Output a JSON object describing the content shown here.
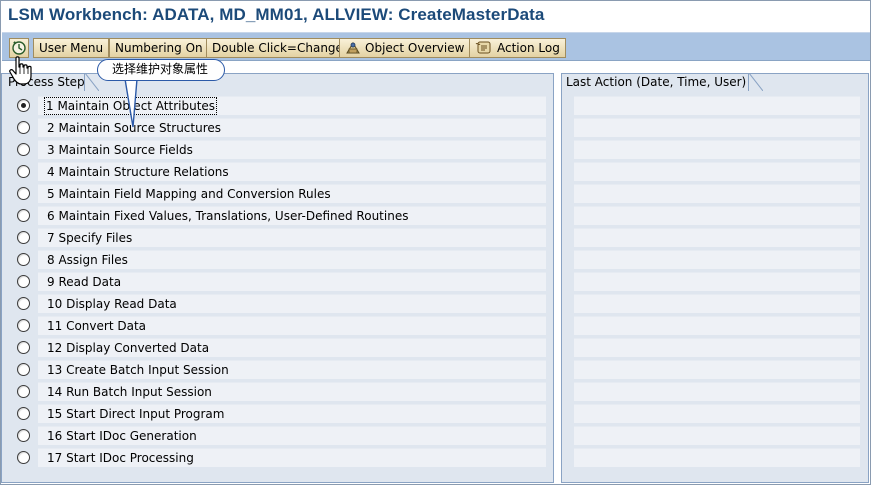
{
  "window": {
    "title": "LSM Workbench: ADATA, MD_MM01, ALLVIEW: CreateMasterData"
  },
  "toolbar": {
    "execute_icon": "execute-clock-icon",
    "buttons": [
      {
        "label": "User Menu"
      },
      {
        "label": "Numbering On"
      },
      {
        "label": "Double Click=Change"
      },
      {
        "label": "Object Overview",
        "icon": "object-overview-icon"
      },
      {
        "label": "Action Log",
        "icon": "action-log-icon"
      }
    ]
  },
  "tooltip": {
    "text": "选择维护对象属性"
  },
  "process_panel": {
    "header": "Process Step",
    "selected_index": 0,
    "steps": [
      {
        "label": "1 Maintain Object Attributes"
      },
      {
        "label": "2 Maintain Source Structures"
      },
      {
        "label": "3 Maintain Source Fields"
      },
      {
        "label": "4 Maintain Structure Relations"
      },
      {
        "label": "5 Maintain Field Mapping and Conversion Rules"
      },
      {
        "label": "6 Maintain Fixed Values, Translations, User-Defined Routines"
      },
      {
        "label": "7 Specify Files"
      },
      {
        "label": "8 Assign Files"
      },
      {
        "label": "9 Read Data"
      },
      {
        "label": "10 Display Read Data"
      },
      {
        "label": "11 Convert Data"
      },
      {
        "label": "12 Display Converted Data"
      },
      {
        "label": "13 Create Batch Input Session"
      },
      {
        "label": "14 Run Batch Input Session"
      },
      {
        "label": "15 Start Direct Input Program"
      },
      {
        "label": "16 Start IDoc Generation"
      },
      {
        "label": "17 Start IDoc Processing"
      }
    ]
  },
  "action_panel": {
    "header": "Last Action (Date, Time, User)"
  },
  "colors": {
    "title": "#1c4a79",
    "toolbar_bg": "#aac3e2",
    "button_bg": "#e9dcb5",
    "panel_bg": "#dfe6ef",
    "cell_bg": "#eef1f6",
    "tooltip_border": "#2c5aa8"
  }
}
